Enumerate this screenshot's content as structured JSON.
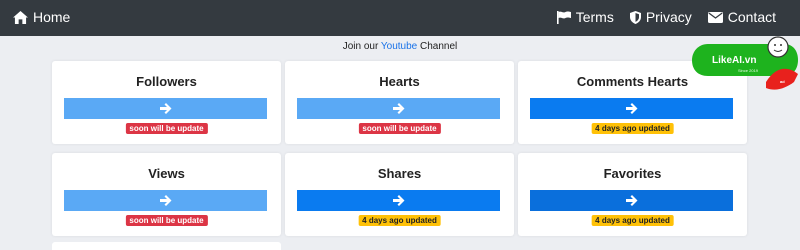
{
  "nav": {
    "home_label": "Home",
    "links": [
      {
        "label": "Terms",
        "icon": "flag-icon"
      },
      {
        "label": "Privacy",
        "icon": "shield-icon"
      },
      {
        "label": "Contact",
        "icon": "envelope-icon"
      }
    ]
  },
  "banner": {
    "prefix": "Join our ",
    "link": "Youtube",
    "suffix": " Channel"
  },
  "cards": [
    {
      "title": "Followers",
      "button_color": "#5aa9f5",
      "status": "soon will be update",
      "status_type": "red"
    },
    {
      "title": "Hearts",
      "button_color": "#5aa9f5",
      "status": "soon will be update",
      "status_type": "red"
    },
    {
      "title": "Comments Hearts",
      "button_color": "#0a7bf0",
      "status": "4 days ago updated",
      "status_type": "yellow"
    },
    {
      "title": "Views",
      "button_color": "#5aa9f5",
      "status": "soon will be update",
      "status_type": "red"
    },
    {
      "title": "Shares",
      "button_color": "#0a7bf0",
      "status": "4 days ago updated",
      "status_type": "yellow"
    },
    {
      "title": "Favorites",
      "button_color": "#0a6fdc",
      "status": "4 days ago updated",
      "status_type": "yellow"
    }
  ],
  "logo": {
    "text": "LikeAI.vn",
    "tagline": "Since 2019",
    "colors": {
      "green": "#1eb31e",
      "red": "#e8211d"
    }
  },
  "colors": {
    "navbar": "#343a40",
    "background": "#eceef2",
    "badge_red": "#dc3545",
    "badge_yellow": "#ffc107"
  }
}
